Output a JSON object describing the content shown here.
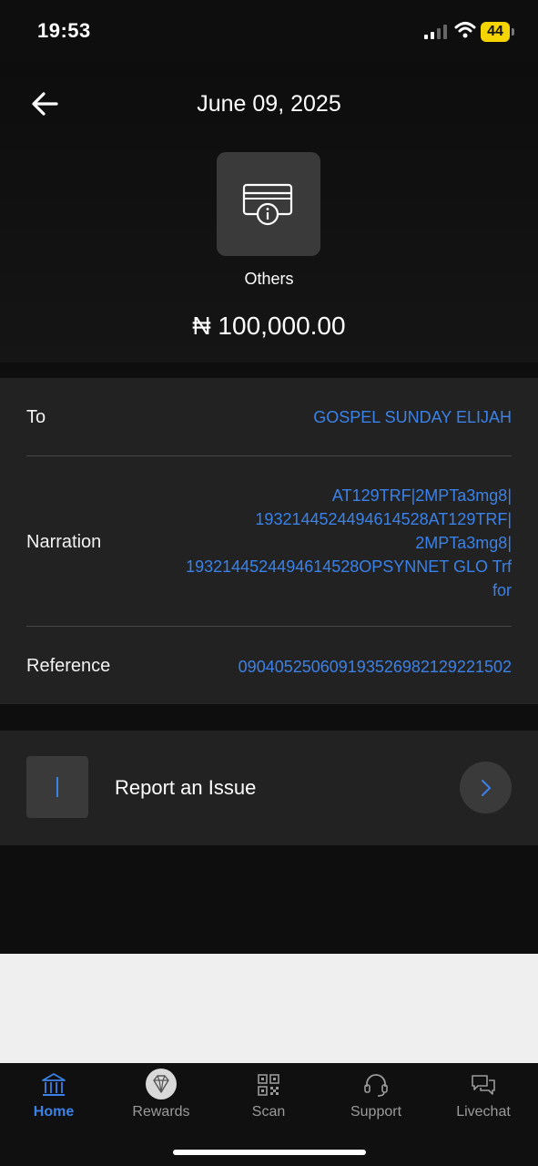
{
  "status_bar": {
    "time": "19:53",
    "battery": "44"
  },
  "header": {
    "date": "June 09, 2025",
    "category": "Others",
    "amount": "₦ 100,000.00"
  },
  "details": {
    "to_label": "To",
    "to_value": "GOSPEL SUNDAY ELIJAH",
    "narration_label": "Narration",
    "narration_lines": [
      "AT129TRF|2MPTa3mg8|",
      "1932144524494614528AT129TRF|",
      "2MPTa3mg8|",
      "1932144524494614528OPSYNNET GLO Trf",
      "for"
    ],
    "reference_label": "Reference",
    "reference_value": "090405250609193526982129221502"
  },
  "report": {
    "label": "Report an Issue"
  },
  "tabs": [
    {
      "label": "Home",
      "icon": "bank-icon",
      "active": true
    },
    {
      "label": "Rewards",
      "icon": "diamond-icon",
      "active": false
    },
    {
      "label": "Scan",
      "icon": "qr-code-icon",
      "active": false
    },
    {
      "label": "Support",
      "icon": "headset-icon",
      "active": false
    },
    {
      "label": "Livechat",
      "icon": "chat-bubbles-icon",
      "active": false
    }
  ],
  "colors": {
    "accent": "#3b82e8",
    "card": "#222222",
    "tile": "#3a3a3a"
  }
}
